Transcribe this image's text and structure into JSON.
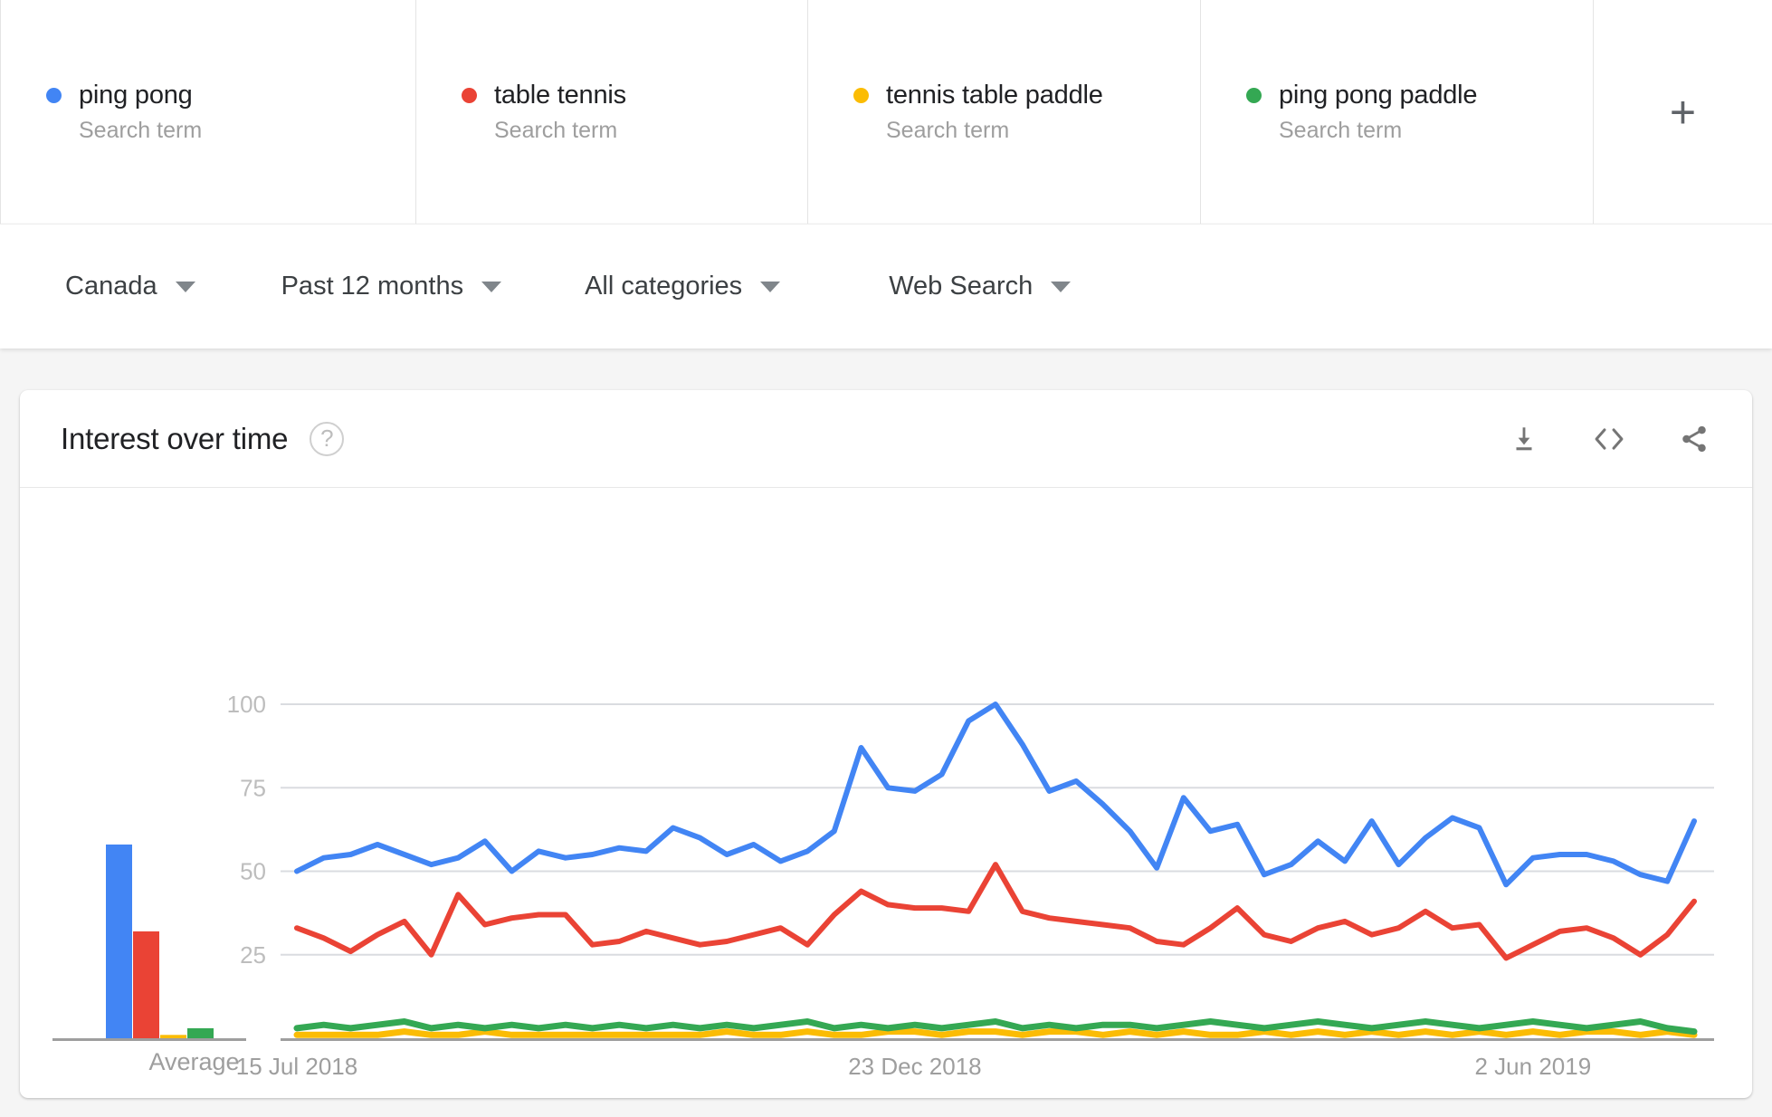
{
  "terms": [
    {
      "label": "ping pong",
      "sub": "Search term",
      "color": "#4285f4"
    },
    {
      "label": "table tennis",
      "sub": "Search term",
      "color": "#ea4335"
    },
    {
      "label": "tennis table paddle",
      "sub": "Search term",
      "color": "#fbbc04"
    },
    {
      "label": "ping pong paddle",
      "sub": "Search term",
      "color": "#34a853"
    }
  ],
  "add_term_icon": "plus-icon",
  "filters": [
    {
      "label": "Canada"
    },
    {
      "label": "Past 12 months"
    },
    {
      "label": "All categories"
    },
    {
      "label": "Web Search"
    }
  ],
  "card": {
    "title": "Interest over time",
    "help_icon": "?",
    "actions": [
      {
        "name": "download-icon"
      },
      {
        "name": "embed-code-icon"
      },
      {
        "name": "share-icon"
      }
    ]
  },
  "chart_data": {
    "type": "line",
    "title": "Interest over time",
    "xlabel": "",
    "ylabel": "",
    "ylim": [
      0,
      100
    ],
    "yticks": [
      100,
      75,
      50,
      25
    ],
    "grid": true,
    "legend": "top",
    "x_tick_labels": [
      "15 Jul 2018",
      "23 Dec 2018",
      "2 Jun 2019"
    ],
    "x_tick_positions": [
      0,
      23,
      46
    ],
    "n_points": 53,
    "series": [
      {
        "name": "ping pong",
        "color": "#4285f4",
        "average": 58,
        "values": [
          50,
          54,
          55,
          58,
          55,
          52,
          54,
          59,
          50,
          56,
          54,
          55,
          57,
          56,
          63,
          60,
          55,
          58,
          53,
          56,
          62,
          87,
          75,
          74,
          79,
          95,
          100,
          88,
          74,
          77,
          70,
          62,
          51,
          72,
          62,
          64,
          49,
          52,
          59,
          53,
          65,
          52,
          60,
          66,
          63,
          46,
          54,
          55,
          55,
          53,
          49,
          47,
          65
        ]
      },
      {
        "name": "table tennis",
        "color": "#ea4335",
        "average": 32,
        "values": [
          33,
          30,
          26,
          31,
          35,
          25,
          43,
          34,
          36,
          37,
          37,
          28,
          29,
          32,
          30,
          28,
          29,
          31,
          33,
          28,
          37,
          44,
          40,
          39,
          39,
          38,
          52,
          38,
          36,
          35,
          34,
          33,
          29,
          28,
          33,
          39,
          31,
          29,
          33,
          35,
          31,
          33,
          38,
          33,
          34,
          24,
          28,
          32,
          33,
          30,
          25,
          31,
          41
        ]
      },
      {
        "name": "tennis table paddle",
        "color": "#fbbc04",
        "average": 1,
        "values": [
          1,
          1,
          1,
          1,
          2,
          1,
          1,
          2,
          1,
          1,
          1,
          1,
          1,
          1,
          1,
          1,
          2,
          1,
          1,
          2,
          1,
          1,
          2,
          2,
          1,
          2,
          2,
          1,
          2,
          2,
          1,
          2,
          1,
          2,
          1,
          1,
          2,
          1,
          2,
          1,
          2,
          1,
          2,
          1,
          2,
          1,
          2,
          1,
          2,
          2,
          1,
          2,
          1
        ]
      },
      {
        "name": "ping pong paddle",
        "color": "#34a853",
        "average": 3,
        "values": [
          3,
          4,
          3,
          4,
          5,
          3,
          4,
          3,
          4,
          3,
          4,
          3,
          4,
          3,
          4,
          3,
          4,
          3,
          4,
          5,
          3,
          4,
          3,
          4,
          3,
          4,
          5,
          3,
          4,
          3,
          4,
          4,
          3,
          4,
          5,
          4,
          3,
          4,
          5,
          4,
          3,
          4,
          5,
          4,
          3,
          4,
          5,
          4,
          3,
          4,
          5,
          3,
          2
        ]
      }
    ],
    "average_panel": {
      "label": "Average",
      "values": [
        58,
        32,
        1,
        3
      ]
    }
  }
}
